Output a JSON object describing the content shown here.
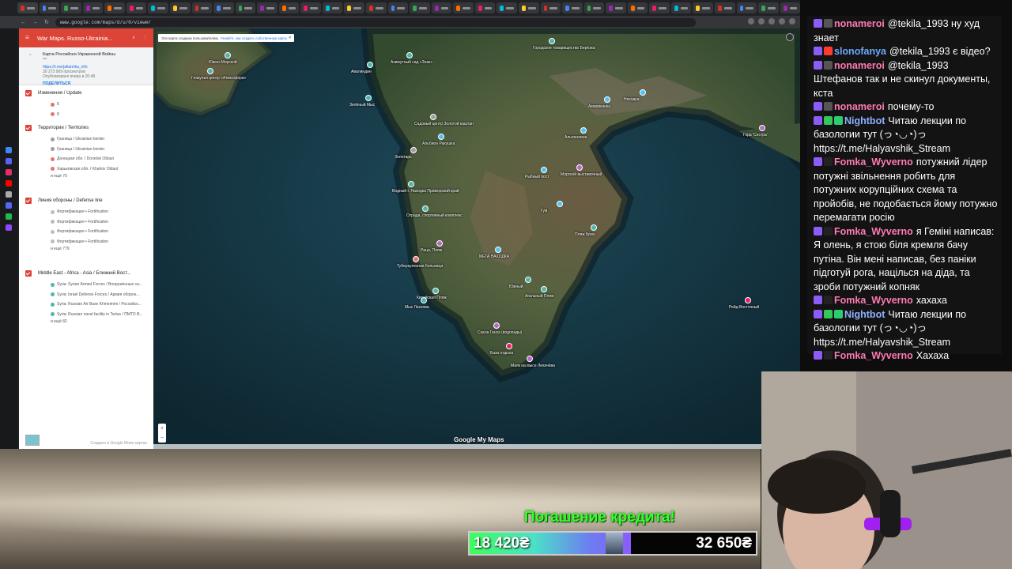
{
  "browser": {
    "url": "www.google.com/maps/d/u/0/viewer",
    "tab_colors": [
      "#d93025",
      "#4285f4",
      "#34a853",
      "#9c27b0",
      "#ff6d00",
      "#e91e63",
      "#00bcd4",
      "#ffca28"
    ]
  },
  "panel": {
    "title": "War Maps. Russo-Ukrainia...",
    "map_name": "Карта Российско-Украинской Войны",
    "map_dots": "•••",
    "link": "https://t.me/jaltamika_info",
    "views": "30 273 969 просмотров",
    "published": "Опубликовано вчера в 20:48",
    "share": "ПОДЕЛИТЬСЯ",
    "layers": [
      {
        "name": "Изменения / Update",
        "items": [
          {
            "text": "8",
            "color": "#e57373"
          },
          {
            "text": "8",
            "color": "#e57373"
          }
        ],
        "more": ""
      },
      {
        "name": "Территории / Territories",
        "items": [
          {
            "text": "Граница / Ukrainian border",
            "color": "#9e9e9e"
          },
          {
            "text": "Граница / Ukrainian border",
            "color": "#9e9e9e"
          },
          {
            "text": "Донецкая обл. / Donetsk Oblast",
            "color": "#e57373"
          },
          {
            "text": "Харьковская обл. / Kharkiv Oblast",
            "color": "#e57373"
          }
        ],
        "more": "и ещё 70"
      },
      {
        "name": "Линия обороны / Defense line",
        "items": [
          {
            "text": "Фортификация • Fortification",
            "color": "#bdbdbd"
          },
          {
            "text": "Фортификация • Fortification",
            "color": "#bdbdbd"
          },
          {
            "text": "Фортификация • Fortification",
            "color": "#bdbdbd"
          },
          {
            "text": "Фортификация • Fortification",
            "color": "#bdbdbd"
          }
        ],
        "more": "и ещё 779"
      },
      {
        "name": "Middle East - Africa - Asia / Ближний Вост...",
        "items": [
          {
            "text": "Syria: Syrian Armed Forces / Вооружённые си...",
            "color": "#4db6ac"
          },
          {
            "text": "Syria: Israel Defense Forces / Армия оборон...",
            "color": "#4db6ac"
          },
          {
            "text": "Syria: Russian Air Base Khmeimim / Российск...",
            "color": "#4db6ac"
          },
          {
            "text": "Syria: Russian naval facility in Tartus / ПМТО В...",
            "color": "#4db6ac"
          }
        ],
        "more": "и ещё 82"
      }
    ],
    "footer": "Создано в Google Моих картах"
  },
  "map": {
    "notice": "Эта карта создана пользователем.",
    "notice_link": "Узнайте, как создать собственную карту",
    "brand": "Google My Maps",
    "labels": [
      {
        "text": "Южно-Морской"
      },
      {
        "text": "Глазунья центр «Атмосфера»"
      },
      {
        "text": "Авалиндин"
      },
      {
        "text": "Зелёный Мыс"
      },
      {
        "text": "Азимутный сад «Знак»"
      },
      {
        "text": "Садовый центр Золотой каштан"
      },
      {
        "text": "Альбион Ракушка"
      },
      {
        "text": "Золотарь"
      },
      {
        "text": "Водный г. Находка Приморский край"
      },
      {
        "text": "Отрада, спортивный комплекс"
      },
      {
        "text": "Находка"
      },
      {
        "text": "Городское товарищество Берёзка"
      },
      {
        "text": "Американка"
      },
      {
        "text": "Альпенлина"
      },
      {
        "text": "Морской выставочный"
      },
      {
        "text": "Рыбный пост"
      },
      {
        "text": "Гум"
      },
      {
        "text": "Пляж Бриз"
      },
      {
        "text": "Рица, Пляж"
      },
      {
        "text": "Туберкулезная больница"
      },
      {
        "text": "МЕГА НАХОДКА"
      },
      {
        "text": "Южный"
      },
      {
        "text": "Китайская Пляж"
      },
      {
        "text": "Мыс Ласкова"
      },
      {
        "text": "Агальный Пляж"
      },
      {
        "text": "Скала Геноз (водопады)"
      },
      {
        "text": "База отдыха"
      },
      {
        "text": "Маяк на мысе Лихачёва"
      },
      {
        "text": "Гора 'Сестра'"
      },
      {
        "text": "Рейд Восточный"
      }
    ]
  },
  "chat": [
    {
      "name": "nonameroi",
      "color": "#ff7ab5",
      "badges": [
        "#8b5cf6",
        "#555"
      ],
      "text": "@tekila_1993 ну худ знает"
    },
    {
      "name": "slonofanya",
      "color": "#6ea8ff",
      "badges": [
        "#8b5cf6",
        "#ff3b30"
      ],
      "text": "@tekila_1993 є відео?"
    },
    {
      "name": "nonameroi",
      "color": "#ff7ab5",
      "badges": [
        "#8b5cf6",
        "#555"
      ],
      "text": "@tekila_1993 Штефанов так и не скинул документы, кста"
    },
    {
      "name": "nonameroi",
      "color": "#ff7ab5",
      "badges": [
        "#8b5cf6",
        "#555"
      ],
      "text": "почему-то"
    },
    {
      "name": "Nightbot",
      "color": "#8fb0ff",
      "badges": [
        "#8b5cf6",
        "#34c759",
        "#2ecc71"
      ],
      "text": "Читаю лекции по базологии тут (っ◔◡◔)っ https://t.me/Halyavshik_Stream"
    },
    {
      "name": "Fomka_Wyverno",
      "color": "#ff7ab5",
      "badges": [
        "#8b5cf6",
        "#222"
      ],
      "text": "потужний лідер потужні звільнення робить для потужних корупційних схема та пройобів, не подобається йому потужно перемагати росію"
    },
    {
      "name": "Fomka_Wyverno",
      "color": "#ff7ab5",
      "badges": [
        "#8b5cf6",
        "#222"
      ],
      "text": "я Геміні написав: Я олень, я стою біля кремля бачу путіна. Він мені написав, без паніки підготуй рога, націлься на діда, та зроби потужний копняк"
    },
    {
      "name": "Fomka_Wyverno",
      "color": "#ff7ab5",
      "badges": [
        "#8b5cf6",
        "#222"
      ],
      "text": "хахаха"
    },
    {
      "name": "Nightbot",
      "color": "#8fb0ff",
      "badges": [
        "#8b5cf6",
        "#34c759",
        "#2ecc71"
      ],
      "text": "Читаю лекции по базологии тут (っ◔◡◔)っ https://t.me/Halyavshik_Stream"
    },
    {
      "name": "Fomka_Wyverno",
      "color": "#ff7ab5",
      "badges": [
        "#8b5cf6",
        "#222"
      ],
      "text": "Хахаха"
    }
  ],
  "donation": {
    "title": "Погашение кредита!",
    "current": "18 420₴",
    "goal": "32 650₴",
    "progress": 0.564
  }
}
